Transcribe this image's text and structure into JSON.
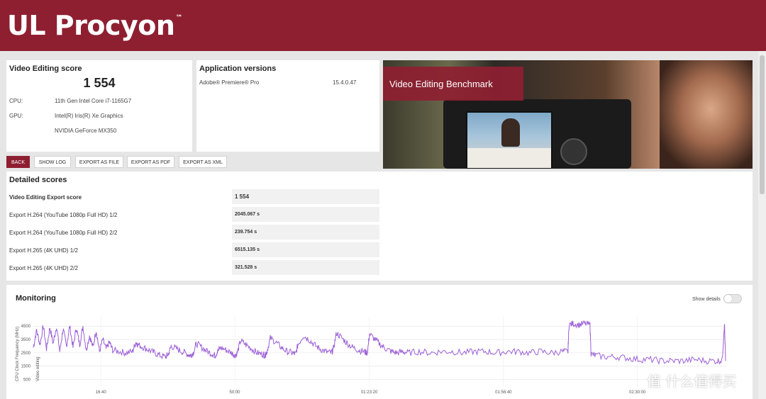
{
  "app": {
    "title": "UL Procyon",
    "tm": "™"
  },
  "score_panel": {
    "title": "Video Editing score",
    "score": "1 554",
    "cpu_label": "CPU:",
    "cpu_value": "11th Gen Intel Core i7-1165G7",
    "gpu_label": "GPU:",
    "gpu_value_1": "Intel(R) Iris(R) Xe Graphics",
    "gpu_value_2": "NVIDIA GeForce MX350"
  },
  "app_versions": {
    "title": "Application versions",
    "app_name": "Adobe® Premiere® Pro",
    "app_version": "15.4.0.47"
  },
  "benchmark_banner": {
    "label": "Video Editing Benchmark"
  },
  "toolbar": {
    "back": "BACK",
    "show_log": "SHOW LOG",
    "export_file": "EXPORT AS FILE",
    "export_pdf": "EXPORT AS PDF",
    "export_xml": "EXPORT AS XML"
  },
  "detailed": {
    "title": "Detailed scores",
    "rows": [
      {
        "label": "Video Editing Export score",
        "value": "1 554"
      },
      {
        "label": "Export H.264 (YouTube 1080p Full HD) 1/2",
        "value": "2045.067 s"
      },
      {
        "label": "Export H.264 (YouTube 1080p Full HD) 2/2",
        "value": "239.754 s"
      },
      {
        "label": "Export H.265 (4K UHD) 1/2",
        "value": "6515.135 s"
      },
      {
        "label": "Export H.265 (4K UHD) 2/2",
        "value": "321.528 s"
      }
    ]
  },
  "monitoring": {
    "title": "Monitoring",
    "show_details_label": "Show details",
    "show_details_on": false
  },
  "chart_data": {
    "type": "line",
    "ylabel": "CPU Clock Frequency (MHz)",
    "annotation": "Video editing",
    "yticks": [
      4500,
      3500,
      2500,
      1500,
      500
    ],
    "xticks": [
      "16:40",
      "50:00",
      "01:23:20",
      "01:56:40",
      "02:30:00"
    ],
    "ylim": [
      0,
      5200
    ],
    "series": [
      {
        "color": "#9b5fd6",
        "points": [
          [
            0,
            2900
          ],
          [
            60,
            4200
          ],
          [
            120,
            3100
          ],
          [
            180,
            4500
          ],
          [
            240,
            2800
          ],
          [
            300,
            4400
          ],
          [
            360,
            3200
          ],
          [
            420,
            4500
          ],
          [
            480,
            2600
          ],
          [
            540,
            4300
          ],
          [
            600,
            3000
          ],
          [
            660,
            4500
          ],
          [
            720,
            2900
          ],
          [
            780,
            4400
          ],
          [
            840,
            3100
          ],
          [
            900,
            4500
          ],
          [
            960,
            2700
          ],
          [
            1020,
            3800
          ],
          [
            1080,
            2900
          ],
          [
            1140,
            4200
          ],
          [
            1200,
            2600
          ],
          [
            1260,
            3500
          ],
          [
            1320,
            2800
          ],
          [
            1380,
            3300
          ],
          [
            1440,
            2700
          ],
          [
            1560,
            2600
          ],
          [
            1680,
            2500
          ],
          [
            1800,
            2600
          ],
          [
            1860,
            3300
          ],
          [
            1900,
            3100
          ],
          [
            2000,
            2900
          ],
          [
            2100,
            2700
          ],
          [
            2200,
            2500
          ],
          [
            2300,
            2300
          ],
          [
            2400,
            2200
          ],
          [
            2450,
            2400
          ],
          [
            2500,
            3000
          ],
          [
            2600,
            2800
          ],
          [
            2700,
            2600
          ],
          [
            2800,
            2400
          ],
          [
            2850,
            2300
          ],
          [
            2900,
            2500
          ],
          [
            2960,
            3200
          ],
          [
            3060,
            2900
          ],
          [
            3160,
            2600
          ],
          [
            3260,
            2400
          ],
          [
            3300,
            2300
          ],
          [
            3340,
            2600
          ],
          [
            3400,
            2900
          ],
          [
            3500,
            2700
          ],
          [
            3600,
            2500
          ],
          [
            3660,
            2300
          ],
          [
            3700,
            2500
          ],
          [
            3760,
            3400
          ],
          [
            3860,
            3100
          ],
          [
            3960,
            2800
          ],
          [
            4060,
            2500
          ],
          [
            4160,
            2400
          ],
          [
            4200,
            2300
          ],
          [
            4240,
            2600
          ],
          [
            4300,
            3600
          ],
          [
            4400,
            3300
          ],
          [
            4500,
            2900
          ],
          [
            4600,
            2600
          ],
          [
            4700,
            2500
          ],
          [
            4760,
            2400
          ],
          [
            4800,
            3100
          ],
          [
            4900,
            3800
          ],
          [
            5000,
            3500
          ],
          [
            5100,
            3100
          ],
          [
            5200,
            2800
          ],
          [
            5300,
            2600
          ],
          [
            5400,
            2500
          ],
          [
            5440,
            2700
          ],
          [
            5500,
            4000
          ],
          [
            5600,
            3600
          ],
          [
            5700,
            3200
          ],
          [
            5800,
            2900
          ],
          [
            5900,
            2700
          ],
          [
            6000,
            2600
          ],
          [
            6060,
            2500
          ],
          [
            6100,
            3900
          ],
          [
            6200,
            3500
          ],
          [
            6300,
            3100
          ],
          [
            6400,
            2800
          ],
          [
            6500,
            2600
          ],
          [
            6600,
            2500
          ],
          [
            6700,
            2600
          ],
          [
            6800,
            2500
          ],
          [
            7000,
            2600
          ],
          [
            7200,
            2500
          ],
          [
            7400,
            2600
          ],
          [
            7600,
            2600
          ],
          [
            7800,
            2500
          ],
          [
            8000,
            2600
          ],
          [
            8200,
            2600
          ],
          [
            8400,
            2500
          ],
          [
            8600,
            2600
          ],
          [
            8800,
            2600
          ],
          [
            9000,
            2500
          ],
          [
            9200,
            2600
          ],
          [
            9400,
            2500
          ],
          [
            9600,
            2600
          ],
          [
            9700,
            2600
          ],
          [
            9720,
            4600
          ],
          [
            9800,
            4700
          ],
          [
            9900,
            4600
          ],
          [
            10000,
            4700
          ],
          [
            10100,
            4600
          ],
          [
            10120,
            2400
          ],
          [
            10200,
            2300
          ],
          [
            10400,
            2200
          ],
          [
            10600,
            2200
          ],
          [
            10800,
            2100
          ],
          [
            11000,
            2000
          ],
          [
            11200,
            2000
          ],
          [
            11400,
            1900
          ],
          [
            11600,
            1900
          ],
          [
            11800,
            1900
          ],
          [
            12000,
            2000
          ],
          [
            12200,
            1900
          ],
          [
            12400,
            1900
          ],
          [
            12500,
            1950
          ],
          [
            12540,
            4800
          ],
          [
            12560,
            1900
          ]
        ],
        "xmax": 12560,
        "xtick_positions": [
          1225,
          3655,
          6095,
          8530,
          10960
        ]
      }
    ]
  },
  "watermark": "值 什么值得买"
}
